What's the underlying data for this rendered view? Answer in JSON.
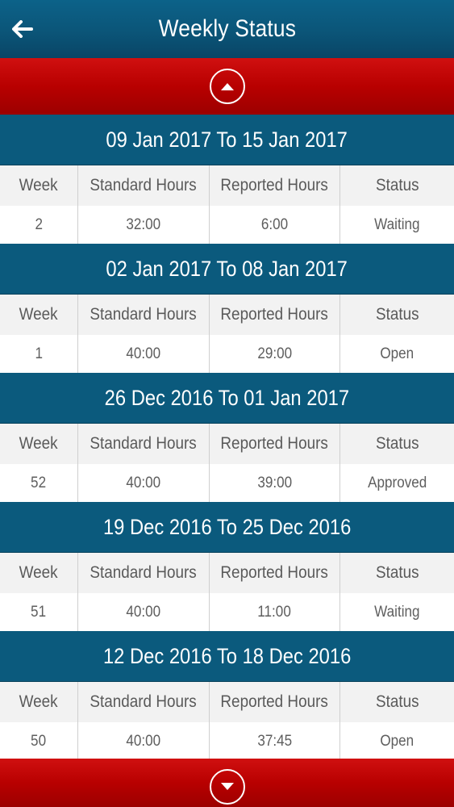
{
  "header": {
    "title": "Weekly Status"
  },
  "columns": {
    "week": "Week",
    "standard": "Standard Hours",
    "reported": "Reported Hours",
    "status": "Status"
  },
  "weeks": [
    {
      "range": "09 Jan 2017 To 15 Jan 2017",
      "week": "2",
      "standard": "32:00",
      "reported": "6:00",
      "status": "Waiting"
    },
    {
      "range": "02 Jan 2017 To 08 Jan 2017",
      "week": "1",
      "standard": "40:00",
      "reported": "29:00",
      "status": "Open"
    },
    {
      "range": "26 Dec 2016 To 01 Jan 2017",
      "week": "52",
      "standard": "40:00",
      "reported": "39:00",
      "status": "Approved"
    },
    {
      "range": "19 Dec 2016 To 25 Dec 2016",
      "week": "51",
      "standard": "40:00",
      "reported": "11:00",
      "status": "Waiting"
    },
    {
      "range": "12 Dec 2016 To 18 Dec 2016",
      "week": "50",
      "standard": "40:00",
      "reported": "37:45",
      "status": "Open"
    }
  ],
  "icons": {
    "back": "arrow-left-icon",
    "scroll_up": "chevron-up-icon",
    "scroll_down": "chevron-down-icon"
  },
  "colors": {
    "header_blue": "#0b5578",
    "week_header_blue": "#0b5a7d",
    "accent_red": "#b80000"
  }
}
